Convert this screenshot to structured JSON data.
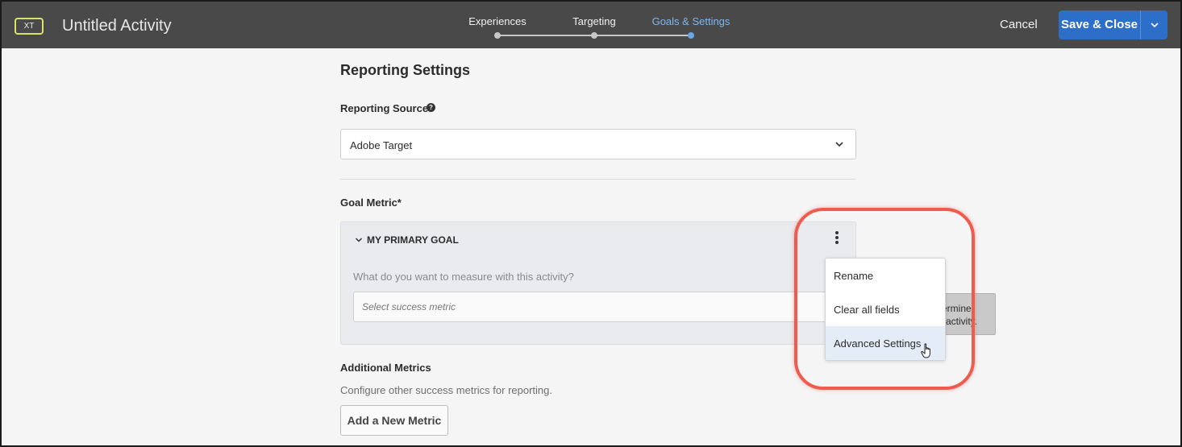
{
  "header": {
    "badge": "XT",
    "title": "Untitled Activity",
    "steps": [
      {
        "label": "Experiences"
      },
      {
        "label": "Targeting"
      },
      {
        "label": "Goals & Settings",
        "active": true
      }
    ],
    "cancel_label": "Cancel",
    "save_label": "Save & Close",
    "active_step_color": "#7fb6ec",
    "save_button_color": "#2d6ec9"
  },
  "main": {
    "section_title": "Reporting Settings",
    "reporting_source_label": "Reporting Source",
    "reporting_source_value": "Adobe Target",
    "goal_metric_label": "Goal Metric*",
    "goal": {
      "name": "MY PRIMARY GOAL",
      "question": "What do you want to measure with this activity?",
      "metric_placeholder": "Select success metric"
    },
    "additional_metrics_title": "Additional Metrics",
    "additional_metrics_subtitle": "Configure other success metrics for reporting.",
    "add_metric_label": "Add a New Metric"
  },
  "tooltip": {
    "line1": "ermine",
    "line2": "activity."
  },
  "menu": {
    "items": [
      {
        "label": "Rename"
      },
      {
        "label": "Clear all fields"
      },
      {
        "label": "Advanced Settings",
        "hovered": true
      }
    ]
  },
  "annotation": {
    "highlight_color": "#ee5c50"
  }
}
